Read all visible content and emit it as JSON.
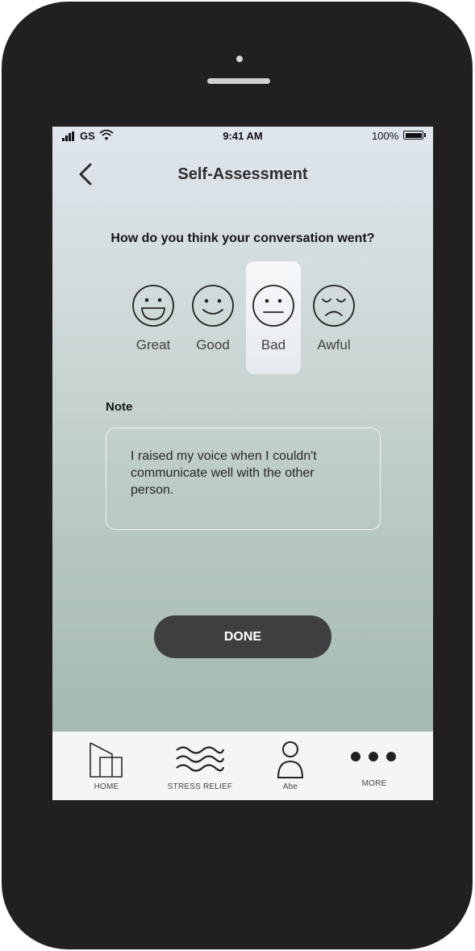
{
  "status_bar": {
    "carrier": "GS",
    "time": "9:41 AM",
    "battery": "100%"
  },
  "header": {
    "title": "Self-Assessment"
  },
  "question": "How do you think your conversation went?",
  "moods": [
    {
      "label": "Great",
      "selected": false
    },
    {
      "label": "Good",
      "selected": false
    },
    {
      "label": "Bad",
      "selected": true
    },
    {
      "label": "Awful",
      "selected": false
    }
  ],
  "note": {
    "label": "Note",
    "value": "I raised my voice when I couldn't communicate well with the other person."
  },
  "done_button": "DONE",
  "tab_bar": {
    "items": [
      {
        "label": "HOME",
        "icon": "home-icon"
      },
      {
        "label": "STRESS RELIEF",
        "icon": "waves-icon"
      },
      {
        "label": "Abe",
        "icon": "person-icon"
      },
      {
        "label": "MORE",
        "icon": "more-icon"
      }
    ]
  }
}
